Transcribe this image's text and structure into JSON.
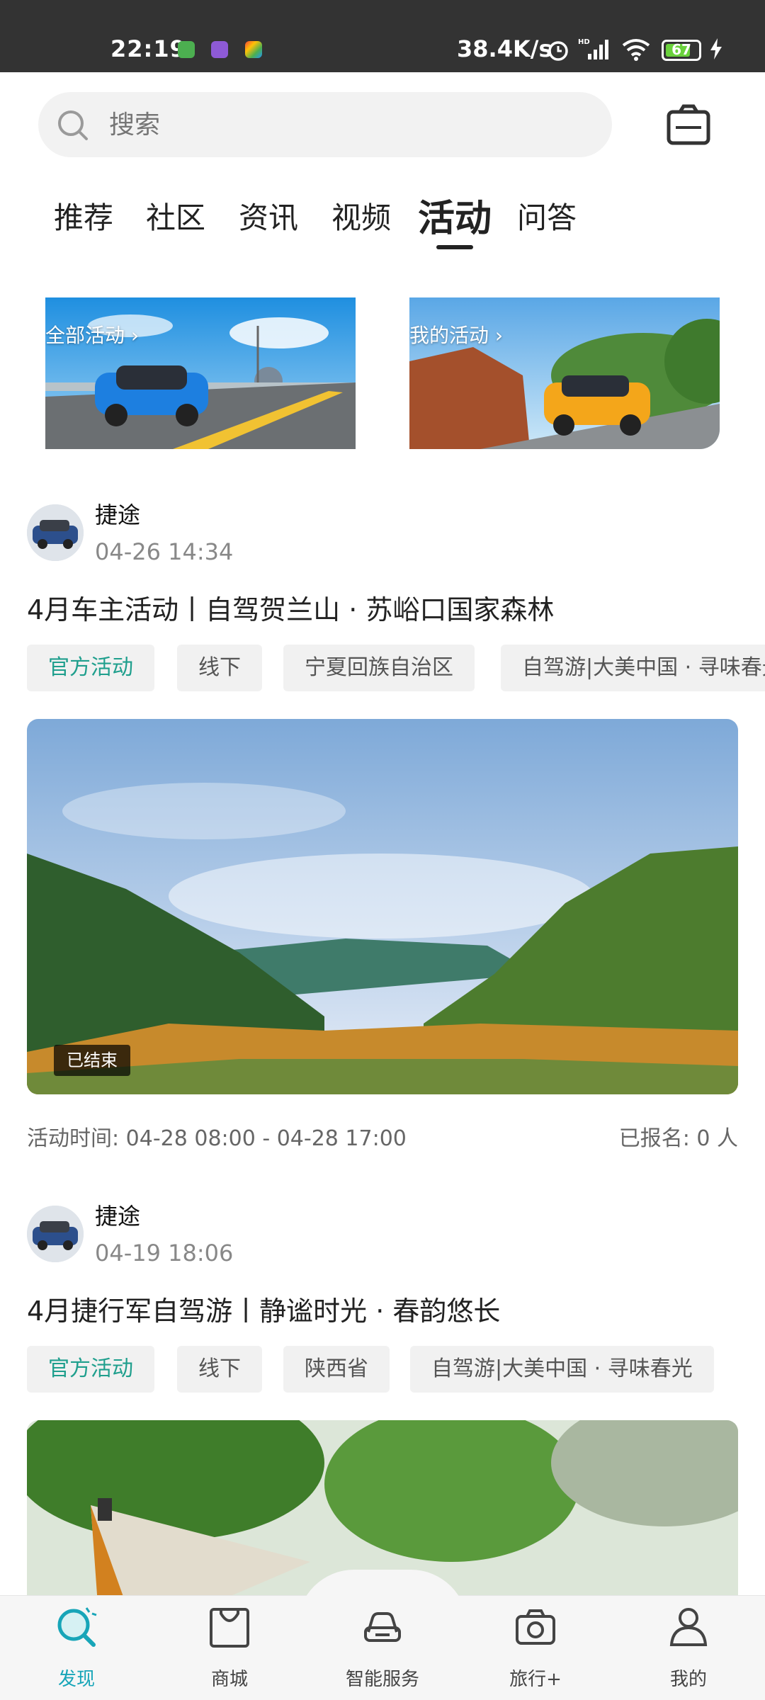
{
  "status_bar": {
    "time": "22:19",
    "network_speed": "38.4K/s",
    "battery": "67",
    "icons": [
      "wechat-app-icon",
      "cloud-app-icon",
      "colorful-app-icon",
      "alarm-icon",
      "hd-signal-icon",
      "wifi-icon",
      "battery-icon",
      "charging-icon"
    ]
  },
  "search": {
    "placeholder": "搜索",
    "scan_icon": "scan-camera-icon"
  },
  "tabs": [
    {
      "label": "推荐",
      "active": false
    },
    {
      "label": "社区",
      "active": false
    },
    {
      "label": "资讯",
      "active": false
    },
    {
      "label": "视频",
      "active": false
    },
    {
      "label": "活动",
      "active": true
    },
    {
      "label": "问答",
      "active": false
    }
  ],
  "banners": [
    {
      "label": "全部活动 ›"
    },
    {
      "label": "我的活动 ›"
    }
  ],
  "posts": [
    {
      "author": "捷途",
      "time": "04-26 14:34",
      "title": "4月车主活动丨自驾贺兰山 · 苏峪口国家森林",
      "tags": [
        "官方活动",
        "线下",
        "宁夏回族自治区",
        "自驾游|大美中国 · 寻味春光"
      ],
      "status_badge": "已结束",
      "activity_time": "活动时间: 04-28 08:00 - 04-28 17:00",
      "signup_count": "已报名: 0 人"
    },
    {
      "author": "捷途",
      "time": "04-19 18:06",
      "title": "4月捷行军自驾游丨静谧时光 · 春韵悠长",
      "tags": [
        "官方活动",
        "线下",
        "陕西省",
        "自驾游|大美中国 · 寻味春光"
      ]
    }
  ],
  "bottom_nav": [
    {
      "label": "发现",
      "icon": "discover-icon",
      "active": true
    },
    {
      "label": "商城",
      "icon": "shopping-bag-icon",
      "active": false
    },
    {
      "label": "智能服务",
      "icon": "car-service-icon",
      "active": false
    },
    {
      "label": "旅行+",
      "icon": "travel-camera-icon",
      "active": false
    },
    {
      "label": "我的",
      "icon": "profile-icon",
      "active": false
    }
  ],
  "colors": {
    "accent": "#17a5b8",
    "official_tag": "#1f9f8d",
    "status_bar": "#333333"
  }
}
